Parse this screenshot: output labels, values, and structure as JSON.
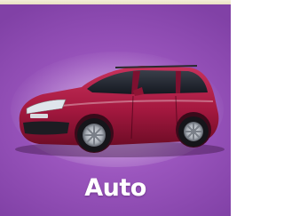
{
  "tile": {
    "label": "Auto",
    "icon": "car-icon",
    "background_color": "#9a55bd",
    "car_color": "#a4183f"
  }
}
